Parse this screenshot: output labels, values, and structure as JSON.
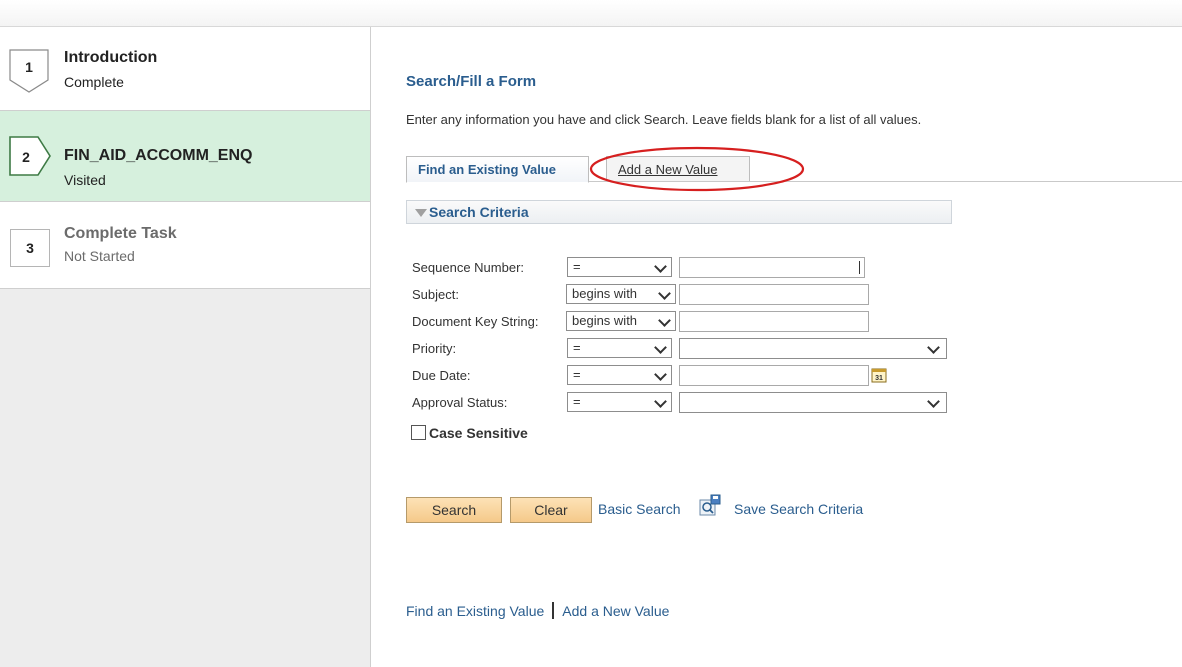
{
  "steps": [
    {
      "number": "1",
      "title": "Introduction",
      "status": "Complete"
    },
    {
      "number": "2",
      "title": "FIN_AID_ACCOMM_ENQ",
      "status": "Visited"
    },
    {
      "number": "3",
      "title": "Complete Task",
      "status": "Not Started"
    }
  ],
  "main": {
    "title": "Search/Fill a Form",
    "instructions": "Enter any information you have and click Search. Leave fields blank for a list of all values.",
    "tabs": [
      {
        "label": "Find an Existing Value"
      },
      {
        "label_underlined": "A",
        "label_rest": "dd a New Value"
      }
    ],
    "criteria_title": "Search Criteria",
    "fields": [
      {
        "label": "Sequence Number:",
        "operator": "=",
        "value": ""
      },
      {
        "label": "Subject:",
        "operator": "begins with",
        "value": ""
      },
      {
        "label": "Document Key String:",
        "operator": "begins with",
        "value": ""
      },
      {
        "label": "Priority:",
        "operator": "=",
        "value": ""
      },
      {
        "label": "Due Date:",
        "operator": "=",
        "value": ""
      },
      {
        "label": "Approval Status:",
        "operator": "=",
        "value": ""
      }
    ],
    "case_sensitive_label": "Case Sensitive",
    "buttons": {
      "search": "Search",
      "clear": "Clear"
    },
    "links": {
      "basic_search": "Basic Search",
      "save_search": "Save Search Criteria"
    },
    "bottom_links": {
      "find_existing": "Find an Existing Value",
      "add_new": "Add a New Value"
    }
  },
  "colors": {
    "accent": "#2a5d8e",
    "annotation": "#d61f1f",
    "step_active_bg": "#d6f0dd",
    "button": "#f5c98a"
  },
  "icons": [
    "calendar-icon",
    "save-search-icon",
    "triangle-down-icon",
    "chevron-down-icon"
  ]
}
